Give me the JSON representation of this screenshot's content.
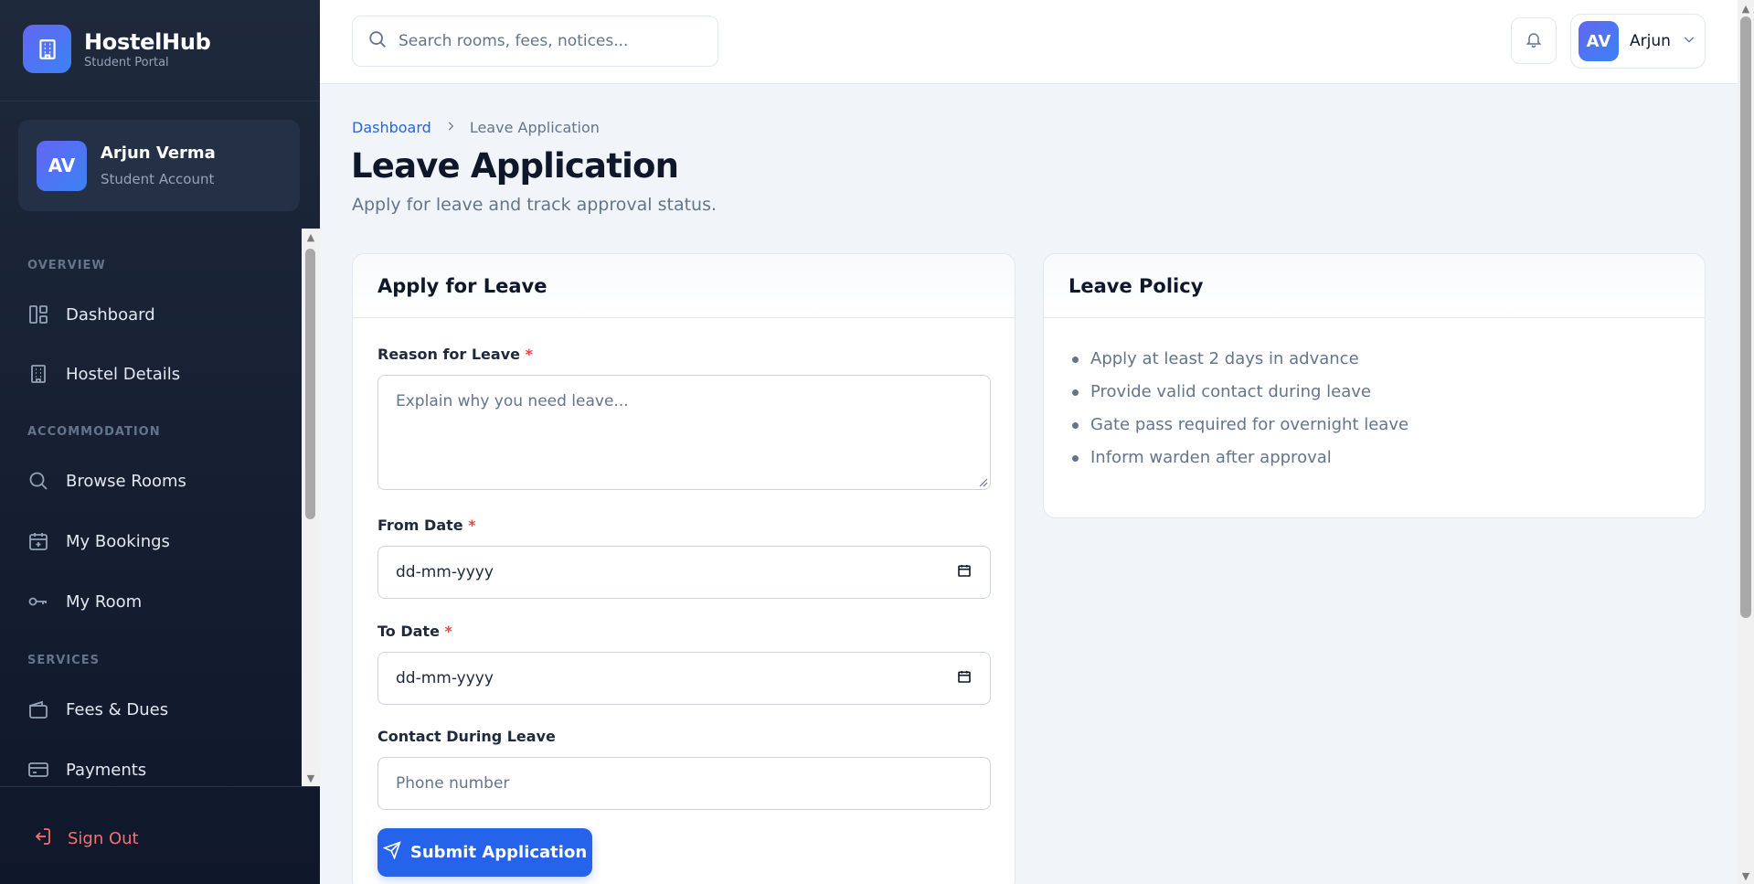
{
  "brand": {
    "name": "HostelHub",
    "subtitle": "Student Portal"
  },
  "user": {
    "initials": "AV",
    "name": "Arjun Verma",
    "role": "Student Account"
  },
  "sidebar": {
    "sections": [
      {
        "title": "OVERVIEW"
      },
      {
        "title": "ACCOMMODATION"
      },
      {
        "title": "SERVICES"
      }
    ],
    "items": [
      {
        "label": "Dashboard",
        "icon": "dashboard-icon"
      },
      {
        "label": "Hostel Details",
        "icon": "building-icon"
      },
      {
        "label": "Browse Rooms",
        "icon": "search-icon"
      },
      {
        "label": "My Bookings",
        "icon": "calendar-plus-icon"
      },
      {
        "label": "My Room",
        "icon": "key-icon"
      },
      {
        "label": "Fees & Dues",
        "icon": "wallet-icon"
      },
      {
        "label": "Payments",
        "icon": "credit-card-icon"
      }
    ],
    "signout_label": "Sign Out"
  },
  "topbar": {
    "search_placeholder": "Search rooms, fees, notices...",
    "profile_initials": "AV",
    "profile_name": "Arjun"
  },
  "breadcrumb": {
    "root": "Dashboard",
    "current": "Leave Application"
  },
  "page": {
    "title": "Leave Application",
    "subtitle": "Apply for leave and track approval status."
  },
  "form": {
    "title": "Apply for Leave",
    "reason_label": "Reason for Leave",
    "reason_placeholder": "Explain why you need leave...",
    "from_label": "From Date",
    "from_value": "dd-mm-yyyy",
    "to_label": "To Date",
    "to_value": "dd-mm-yyyy",
    "contact_label": "Contact During Leave",
    "contact_placeholder": "Phone number",
    "required_mark": "*",
    "submit_label": "Submit Application"
  },
  "policy": {
    "title": "Leave Policy",
    "items": [
      "Apply at least 2 days in advance",
      "Provide valid contact during leave",
      "Gate pass required for overnight leave",
      "Inform warden after approval"
    ]
  },
  "colors": {
    "sidebar_bg": "#1e293b",
    "accent": "#2563eb",
    "brand_gradient_start": "#6366f1",
    "danger": "#ef4444",
    "signout": "#f87171"
  }
}
